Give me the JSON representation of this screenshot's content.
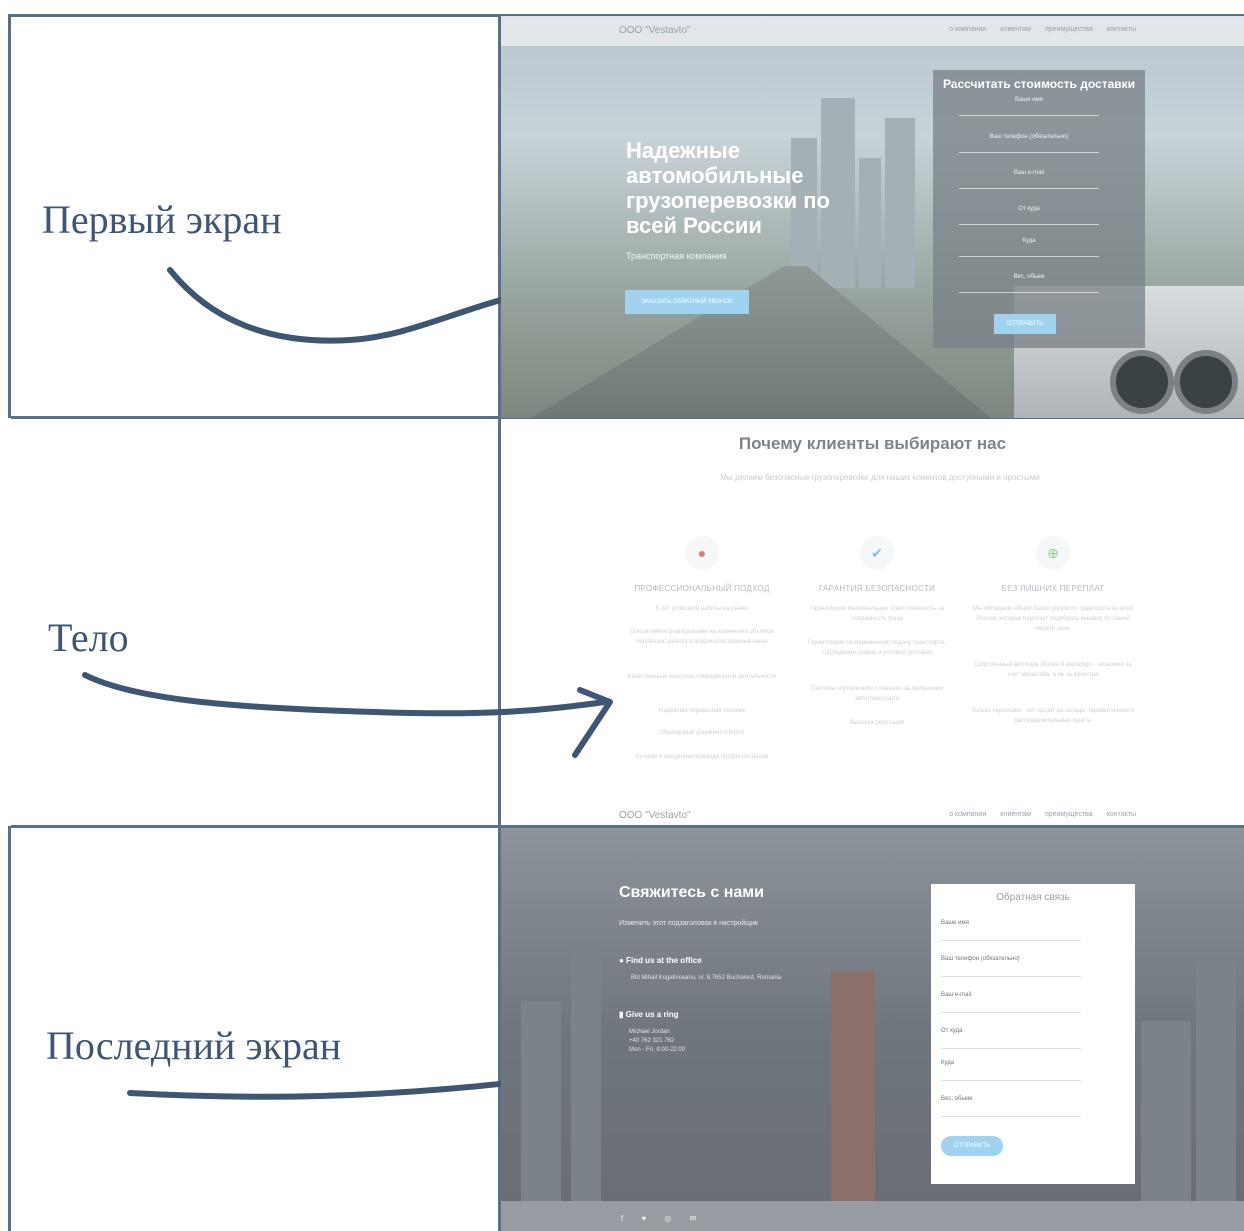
{
  "sections": {
    "first_label": "Первый экран",
    "body_label": "Тело",
    "last_label": "Последний экран"
  },
  "site": {
    "brand": "ООО \"Vestavto\"",
    "nav": [
      "о компании",
      "клиентам",
      "преимущества",
      "контакты"
    ]
  },
  "hero": {
    "title": "Надежные автомобильные грузоперевозки по всей России",
    "subtitle": "Транспортная компания",
    "cta": "ЗАКАЗАТЬ ОБРАТНЫЙ ЗВОНОК"
  },
  "delivery_form": {
    "title": "Рассчитать стоимость доставки",
    "fields": [
      "Ваше имя",
      "Ваш телефон (обязательно)",
      "Ваш e-mail",
      "От куда",
      "Куда",
      "Вес, обьем"
    ],
    "submit": "ОТПРАВИТЬ"
  },
  "why": {
    "title": "Почему клиенты выбирают нас",
    "subtitle": "Мы делаем безопасные грузоперевозки для наших клиентов доступными и простыми",
    "columns": [
      {
        "icon": "chat-icon",
        "heading": "ПРОФЕССИОНАЛЬНЫЙ ПОДХОД",
        "lines": [
          "5 лет успешной работы на рынке",
          "Оперативное реагирование на изменения объемов перевозок: работа в графике/экстренный заказ",
          "Качественный контроль операционной деятельности",
          "Надежная перевозная техника",
          "Образцовый документооборот",
          "Лучшая и преданная команда профессионалов"
        ]
      },
      {
        "icon": "check-icon",
        "heading": "ГАРАНТИЯ БЕЗОПАСНОСТИ",
        "lines": [
          "Гарантируем материальную ответственность за сохранность груза",
          "Гарантируем своевременную подачу транспорта, соблюдение сроков и условий доставки",
          "Система спутникового слежения за движением автотранспорта",
          "Высокая репутация"
        ]
      },
      {
        "icon": "lifebuoy-icon",
        "heading": "БЕЗ ЛИШНИХ ПЕРЕПЛАТ",
        "lines": [
          "Мы обладаем общей базой грузового транспорта по всей России, которая помогает подобрать машину по самой низкой цене",
          "Собственный автопарк (более 8 еврофур) - экономия за счет масштаба, а не за качества",
          "Только перевозки - нет затрат на склады, перевалочные и распределительные пункты"
        ]
      }
    ]
  },
  "contact": {
    "title": "Свяжитесь с нами",
    "subtitle": "Изменить этот подзаголовок в настройщик",
    "office_head": "Find us at the office",
    "office_text": "Bld Mihail Kogalniceanu, nr. 8,7652 Bucharest, Romania",
    "ring_head": "Give us a ring",
    "ring_text": [
      "Michael Jordan",
      "+40 762 321 762",
      "Mon - Fri, 8:00-22:00"
    ]
  },
  "feedback_form": {
    "title": "Обратная связь",
    "fields": [
      "Ваше имя",
      "Ваш телефон (обязательно)",
      "Ваш e-mail",
      "От куда",
      "Куда",
      "Вес, обьем"
    ],
    "submit": "ОТПРАВИТЬ"
  },
  "footer": {
    "icons": [
      "facebook-icon",
      "twitter-icon",
      "instagram-icon",
      "mail-icon"
    ],
    "glyphs": "f ♥ ◎ ✉"
  },
  "colors": {
    "frame": "#5b6f8a",
    "accent": "#9fd3f0",
    "arrow": "#3f5673"
  }
}
